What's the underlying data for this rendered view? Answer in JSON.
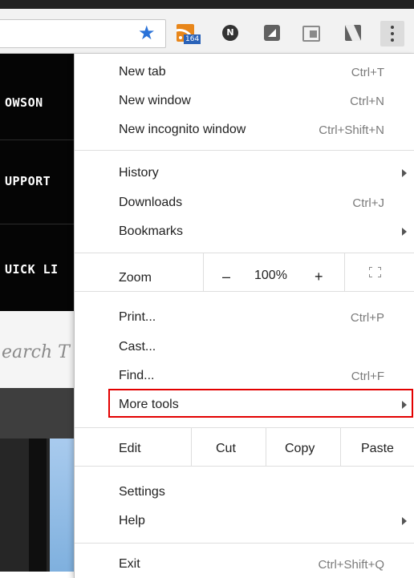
{
  "toolbar": {
    "bookmark_icon": "star-icon",
    "rss_badge": "164",
    "n_extension_letter": "N",
    "menu_icon": "three-dots-icon",
    "accent_star": "#2a72d8"
  },
  "page": {
    "nav_items": [
      "OWSON",
      "UPPORT",
      "UICK LI"
    ],
    "search_placeholder": "earch T"
  },
  "menu": {
    "new_tab": {
      "label": "New tab",
      "shortcut": "Ctrl+T"
    },
    "new_window": {
      "label": "New window",
      "shortcut": "Ctrl+N"
    },
    "new_incognito": {
      "label": "New incognito window",
      "shortcut": "Ctrl+Shift+N"
    },
    "history": {
      "label": "History"
    },
    "downloads": {
      "label": "Downloads",
      "shortcut": "Ctrl+J"
    },
    "bookmarks": {
      "label": "Bookmarks"
    },
    "zoom": {
      "label": "Zoom",
      "minus": "–",
      "value": "100%",
      "plus": "+",
      "fullscreen_icon": "fullscreen-icon"
    },
    "print": {
      "label": "Print...",
      "shortcut": "Ctrl+P"
    },
    "cast": {
      "label": "Cast..."
    },
    "find": {
      "label": "Find...",
      "shortcut": "Ctrl+F"
    },
    "more_tools": {
      "label": "More tools",
      "highlight_color": "#e30000"
    },
    "edit": {
      "label": "Edit",
      "cut": "Cut",
      "copy": "Copy",
      "paste": "Paste"
    },
    "settings": {
      "label": "Settings"
    },
    "help": {
      "label": "Help"
    },
    "exit": {
      "label": "Exit",
      "shortcut": "Ctrl+Shift+Q"
    }
  }
}
